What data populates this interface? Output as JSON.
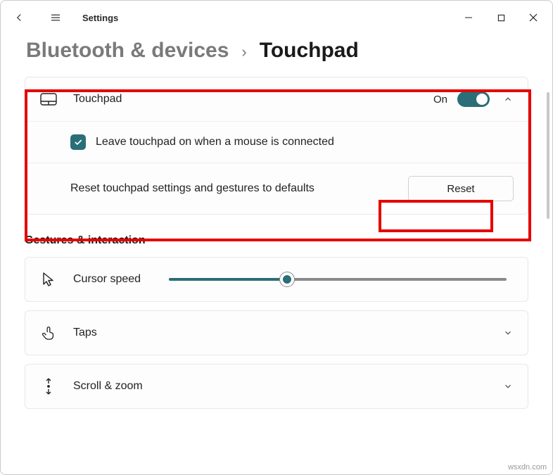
{
  "app": {
    "title": "Settings"
  },
  "breadcrumb": {
    "parent": "Bluetooth & devices",
    "sep": "›",
    "current": "Touchpad"
  },
  "touchpad": {
    "label": "Touchpad",
    "state": "On",
    "leave_on_label": "Leave touchpad on when a mouse is connected",
    "reset_label": "Reset touchpad settings and gestures to defaults",
    "reset_button": "Reset"
  },
  "gestures": {
    "heading": "Gestures & interaction",
    "cursor_speed": "Cursor speed",
    "taps": "Taps",
    "scroll_zoom": "Scroll & zoom"
  },
  "watermark": "wsxdn.com"
}
